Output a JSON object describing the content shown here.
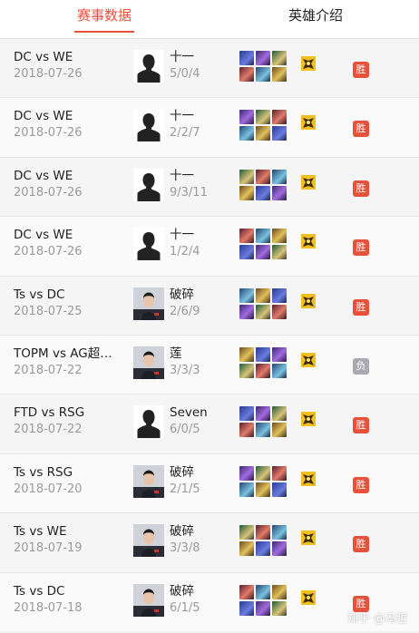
{
  "tabs": [
    {
      "label": "赛事数据",
      "active": true
    },
    {
      "label": "英雄介绍",
      "active": false
    }
  ],
  "accent_color": "#e8503a",
  "matches": [
    {
      "match": "DC vs WE",
      "date": "2018-07-26",
      "player": "十一",
      "kda": "5/0/4",
      "avatar": "silhouette-avatar",
      "result": "胜",
      "result_color": "#e8503a"
    },
    {
      "match": "DC vs WE",
      "date": "2018-07-26",
      "player": "十一",
      "kda": "2/2/7",
      "avatar": "silhouette-avatar",
      "result": "胜",
      "result_color": "#e8503a"
    },
    {
      "match": "DC vs WE",
      "date": "2018-07-26",
      "player": "十一",
      "kda": "9/3/11",
      "avatar": "silhouette-avatar",
      "result": "胜",
      "result_color": "#e8503a"
    },
    {
      "match": "DC vs WE",
      "date": "2018-07-26",
      "player": "十一",
      "kda": "1/2/4",
      "avatar": "silhouette-avatar",
      "result": "胜",
      "result_color": "#e8503a"
    },
    {
      "match": "Ts vs DC",
      "date": "2018-07-25",
      "player": "破碎",
      "kda": "2/6/9",
      "avatar": "player-photo",
      "result": "胜",
      "result_color": "#e8503a"
    },
    {
      "match": "TOPM vs AG超…",
      "date": "2018-07-22",
      "player": "莲",
      "kda": "3/3/3",
      "avatar": "player-photo",
      "result": "负",
      "result_color": "#a9a9b2"
    },
    {
      "match": "FTD vs RSG",
      "date": "2018-07-22",
      "player": "Seven",
      "kda": "6/0/5",
      "avatar": "silhouette-avatar",
      "result": "胜",
      "result_color": "#e8503a"
    },
    {
      "match": "Ts vs RSG",
      "date": "2018-07-20",
      "player": "破碎",
      "kda": "2/1/5",
      "avatar": "player-photo",
      "result": "胜",
      "result_color": "#e8503a"
    },
    {
      "match": "Ts vs WE",
      "date": "2018-07-19",
      "player": "破碎",
      "kda": "3/3/8",
      "avatar": "player-photo",
      "result": "胜",
      "result_color": "#e8503a"
    },
    {
      "match": "Ts vs DC",
      "date": "2018-07-18",
      "player": "破碎",
      "kda": "6/1/5",
      "avatar": "player-photo",
      "result": "胜",
      "result_color": "#e8503a"
    }
  ],
  "watermark": "知乎 @冯哲"
}
